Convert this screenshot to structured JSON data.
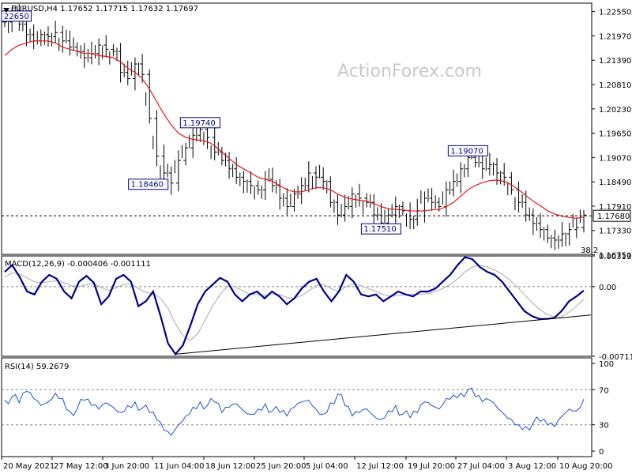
{
  "watermark": "ActionForex.com",
  "chart_data": {
    "type": "candlestick",
    "symbol": "EURUSD,H4",
    "ohlc": [
      "1.17652",
      "1.17715",
      "1.17632",
      "1.17697"
    ],
    "title": "EURUSD,H4  1.17652  1.17715  1.17632  1.17697",
    "price_axis": {
      "ticks": [
        "1.22550",
        "1.21970",
        "1.21390",
        "1.20810",
        "1.20230",
        "1.19650",
        "1.19070",
        "1.18490",
        "1.17910",
        "1.17330",
        "1.16750"
      ],
      "ylim": [
        1.1676,
        1.2275
      ]
    },
    "x_axis": {
      "tick_labels": [
        "20 May 2021",
        "27 May 12:00",
        "3 Jun 20:00",
        "11 Jun 04:00",
        "18 Jun 12:00",
        "25 Jun 20:00",
        "5 Jul 04:00",
        "12 Jul 12:00",
        "19 Jul 20:00",
        "27 Jul 04:00",
        "3 Aug 12:00",
        "10 Aug 20:00"
      ]
    },
    "price_series": [
      1.223,
      1.2245,
      1.2225,
      1.22,
      1.2185,
      1.22,
      1.2195,
      1.2205,
      1.2185,
      1.217,
      1.216,
      1.2145,
      1.2155,
      1.2175,
      1.2165,
      1.216,
      1.211,
      1.2095,
      1.213,
      1.2105,
      1.2,
      1.191,
      1.187,
      1.1846,
      1.19,
      1.193,
      1.196,
      1.1974,
      1.1955,
      1.192,
      1.19,
      1.188,
      1.186,
      1.185,
      1.184,
      1.183,
      1.1855,
      1.184,
      1.181,
      1.179,
      1.182,
      1.184,
      1.187,
      1.186,
      1.185,
      1.18,
      1.177,
      1.179,
      1.182,
      1.181,
      1.18,
      1.177,
      1.1751,
      1.177,
      1.179,
      1.178,
      1.176,
      1.178,
      1.181,
      1.18,
      1.179,
      1.183,
      1.185,
      1.188,
      1.1907,
      1.1895,
      1.188,
      1.189,
      1.187,
      1.186,
      1.183,
      1.18,
      1.177,
      1.175,
      1.1735,
      1.1715,
      1.171,
      1.1725,
      1.1735,
      1.174,
      1.177
    ],
    "moving_average": [
      1.215,
      1.2165,
      1.2175,
      1.218,
      1.2185,
      1.2185,
      1.2185,
      1.218,
      1.217,
      1.2165,
      1.216,
      1.2155,
      1.2155,
      1.215,
      1.2148,
      1.2145,
      1.2135,
      1.212,
      1.211,
      1.2095,
      1.207,
      1.204,
      1.201,
      1.1985,
      1.1965,
      1.1955,
      1.195,
      1.1948,
      1.1945,
      1.1935,
      1.192,
      1.1905,
      1.189,
      1.188,
      1.187,
      1.186,
      1.1855,
      1.185,
      1.184,
      1.183,
      1.1825,
      1.1825,
      1.183,
      1.1835,
      1.1835,
      1.183,
      1.182,
      1.1812,
      1.1808,
      1.1805,
      1.1803,
      1.1797,
      1.179,
      1.1785,
      1.1783,
      1.1782,
      1.178,
      1.1779,
      1.178,
      1.1782,
      1.1783,
      1.179,
      1.18,
      1.1815,
      1.183,
      1.184,
      1.1847,
      1.1852,
      1.1853,
      1.185,
      1.1842,
      1.183,
      1.1816,
      1.1803,
      1.1792,
      1.178,
      1.1772,
      1.1767,
      1.1764,
      1.1762,
      1.1765
    ],
    "price_labels": [
      {
        "text": "22650",
        "value": 1.2245
      },
      {
        "text": "1.19740",
        "value": 1.1974
      },
      {
        "text": "1.18460",
        "value": 1.1846
      },
      {
        "text": "1.17510",
        "value": 1.1751
      },
      {
        "text": "1.19070",
        "value": 1.1907
      }
    ],
    "current_price": {
      "text": "1.17680",
      "value": 1.1768
    },
    "fib_label": "38.2",
    "macd": {
      "label": "MACD(12,26,9) -0.000406 -0.001111",
      "ticks": [
        "0.003133",
        "0.00",
        "-0.007115"
      ],
      "ylim": [
        -0.007115,
        0.003133
      ],
      "macd_series": [
        0.0015,
        0.0022,
        0.001,
        -0.0005,
        -0.0008,
        0.0005,
        0.0012,
        0.0008,
        -0.0005,
        -0.0012,
        0.0005,
        0.0011,
        0.0004,
        -0.0018,
        -0.001,
        0.0008,
        0.0012,
        0.0005,
        -0.002,
        -0.0015,
        -0.0005,
        -0.003,
        -0.0058,
        -0.0069,
        -0.006,
        -0.004,
        -0.0018,
        -0.0005,
        0.0002,
        0.0009,
        0.0005,
        -0.0008,
        -0.0015,
        -0.0008,
        -0.0005,
        -0.0012,
        -0.0005,
        -0.001,
        -0.0018,
        -0.0012,
        -0.0002,
        0.0005,
        0.0008,
        -0.0005,
        -0.0015,
        -0.0005,
        0.0012,
        0.0005,
        -0.0008,
        -0.001,
        -0.0008,
        -0.0015,
        -0.001,
        -0.0005,
        -0.0008,
        -0.001,
        -0.0005,
        -0.0005,
        -0.0002,
        0.0005,
        0.0012,
        0.0022,
        0.003,
        0.0028,
        0.002,
        0.0015,
        0.0012,
        0.0005,
        -0.0005,
        -0.0015,
        -0.0025,
        -0.003,
        -0.0033,
        -0.0033,
        -0.0032,
        -0.0025,
        -0.0015,
        -0.001,
        -0.0004
      ],
      "signal_series": [
        0.001,
        0.0014,
        0.0013,
        0.0009,
        0.0005,
        0.0004,
        0.0005,
        0.0006,
        0.0004,
        0.0001,
        0.0,
        0.0002,
        0.0003,
        -0.0001,
        -0.0004,
        -0.0001,
        0.0002,
        0.0003,
        -0.0002,
        -0.0006,
        -0.0007,
        -0.0012,
        -0.0022,
        -0.0038,
        -0.005,
        -0.0055,
        -0.0048,
        -0.0034,
        -0.002,
        -0.0008,
        0.0,
        0.0,
        -0.0004,
        -0.0008,
        -0.0008,
        -0.0009,
        -0.0008,
        -0.0008,
        -0.0011,
        -0.0012,
        -0.0009,
        -0.0004,
        0.0001,
        0.0002,
        -0.0002,
        -0.0005,
        0.0,
        0.0003,
        0.0001,
        -0.0002,
        -0.0005,
        -0.0008,
        -0.001,
        -0.0009,
        -0.0008,
        -0.0008,
        -0.0008,
        -0.0007,
        -0.0005,
        -0.0002,
        0.0002,
        0.0008,
        0.0015,
        0.002,
        0.0022,
        0.002,
        0.0017,
        0.0013,
        0.0007,
        0.0,
        -0.0008,
        -0.0016,
        -0.0023,
        -0.0028,
        -0.0031,
        -0.0031,
        -0.0026,
        -0.002,
        -0.0013
      ],
      "trendline": [
        [
          23,
          -0.0069
        ],
        [
          79,
          -0.0029
        ]
      ]
    },
    "rsi": {
      "label": "RSI(14) 59.2679",
      "ticks": [
        "100",
        "70",
        "30",
        "0"
      ],
      "levels": [
        70,
        30
      ],
      "ylim": [
        0,
        100
      ],
      "series": [
        58,
        62,
        55,
        68,
        60,
        52,
        56,
        66,
        60,
        45,
        48,
        58,
        52,
        48,
        55,
        50,
        44,
        52,
        56,
        49,
        44,
        36,
        24,
        18,
        30,
        40,
        50,
        56,
        52,
        56,
        44,
        50,
        54,
        46,
        42,
        48,
        54,
        46,
        44,
        40,
        50,
        56,
        58,
        48,
        42,
        55,
        65,
        52,
        40,
        44,
        48,
        40,
        36,
        46,
        52,
        42,
        38,
        44,
        56,
        52,
        48,
        60,
        64,
        66,
        70,
        62,
        56,
        58,
        50,
        42,
        36,
        30,
        28,
        32,
        34,
        30,
        28,
        40,
        48,
        46,
        59.2679
      ]
    }
  }
}
